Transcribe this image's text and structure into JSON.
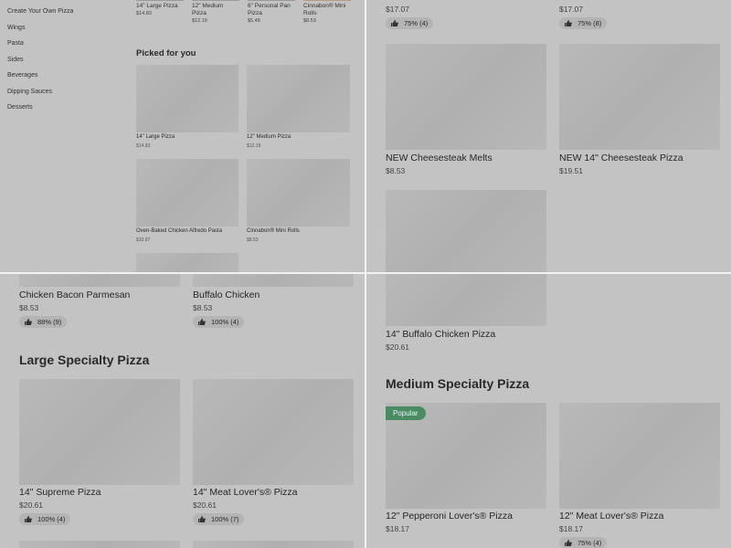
{
  "paneA": {
    "categories": [
      "Create Your Own Pizza",
      "Wings",
      "Pasta",
      "Sides",
      "Beverages",
      "Dipping Sauces",
      "Desserts"
    ],
    "top_items": [
      {
        "name": "14\" Large Pizza",
        "price": "$14.83"
      },
      {
        "name": "12\" Medium Pizza",
        "price": "$12.19"
      },
      {
        "name": "6\" Personal Pan Pizza",
        "price": "$5.48"
      },
      {
        "name": "Cinnabon® Mini Rolls",
        "price": "$8.53"
      }
    ],
    "picked_heading": "Picked for you",
    "picked": [
      {
        "name": "14\" Large Pizza",
        "price": "$14.83"
      },
      {
        "name": "12\" Medium Pizza",
        "price": "$12.19"
      },
      {
        "name": "Oven-Baked Chicken Alfredo Pasta",
        "price": "$10.97"
      },
      {
        "name": "Cinnabon® Mini Rolls",
        "price": "$8.53"
      }
    ]
  },
  "paneB": {
    "top_prices": [
      "$17.07",
      "$17.07"
    ],
    "top_ratings": [
      "75% (4)",
      "75% (8)"
    ],
    "items": [
      {
        "name": "NEW Cheesesteak Melts",
        "price": "$8.53"
      },
      {
        "name": "NEW 14\" Cheesesteak Pizza",
        "price": "$19.51"
      }
    ]
  },
  "paneC": {
    "items": [
      {
        "name": "Chicken Bacon Parmesan",
        "price": "$8.53",
        "rating": "88% (9)"
      },
      {
        "name": "Buffalo Chicken",
        "price": "$8.53",
        "rating": "100% (4)"
      }
    ],
    "section": "Large Specialty Pizza",
    "section_items": [
      {
        "name": "14\" Supreme Pizza",
        "price": "$20.61",
        "rating": "100% (4)"
      },
      {
        "name": "14\" Meat Lover's® Pizza",
        "price": "$20.61",
        "rating": "100% (7)"
      }
    ]
  },
  "paneD": {
    "item": {
      "name": "14\" Buffalo Chicken Pizza",
      "price": "$20.61"
    },
    "section": "Medium Specialty Pizza",
    "badge": "Popular",
    "section_items": [
      {
        "name": "12\" Pepperoni Lover's® Pizza",
        "price": "$18.17"
      },
      {
        "name": "12\" Meat Lover's® Pizza",
        "price": "$18.17",
        "rating": "75% (4)"
      }
    ]
  },
  "colors": {
    "badge": "#4a8c62",
    "overlay": "#c3c3c3"
  }
}
